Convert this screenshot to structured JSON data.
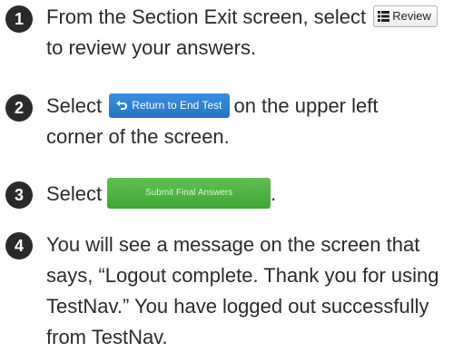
{
  "steps": [
    {
      "number": "1",
      "text_before": "From the Section Exit screen, select",
      "button_label": "Review",
      "button_icon": "list-icon",
      "text_after": "to review your answers."
    },
    {
      "number": "2",
      "text_before": "Select",
      "button_label": "Return to End Test",
      "button_icon": "undo-arrow-icon",
      "text_after": "on the upper left",
      "text_line2": "corner of the screen."
    },
    {
      "number": "3",
      "text_before": "Select",
      "button_label": "Submit Final Answers",
      "text_after": "."
    },
    {
      "number": "4",
      "lines": [
        "You will see a message on the screen that",
        "says, “Logout complete. Thank you for using",
        "TestNav.” You have logged out successfully",
        "from TestNav."
      ]
    }
  ],
  "colors": {
    "badge": "#2a2a2a",
    "return_button": "#2e80d2",
    "submit_button": "#4cb443",
    "text": "#2b2b2b"
  }
}
